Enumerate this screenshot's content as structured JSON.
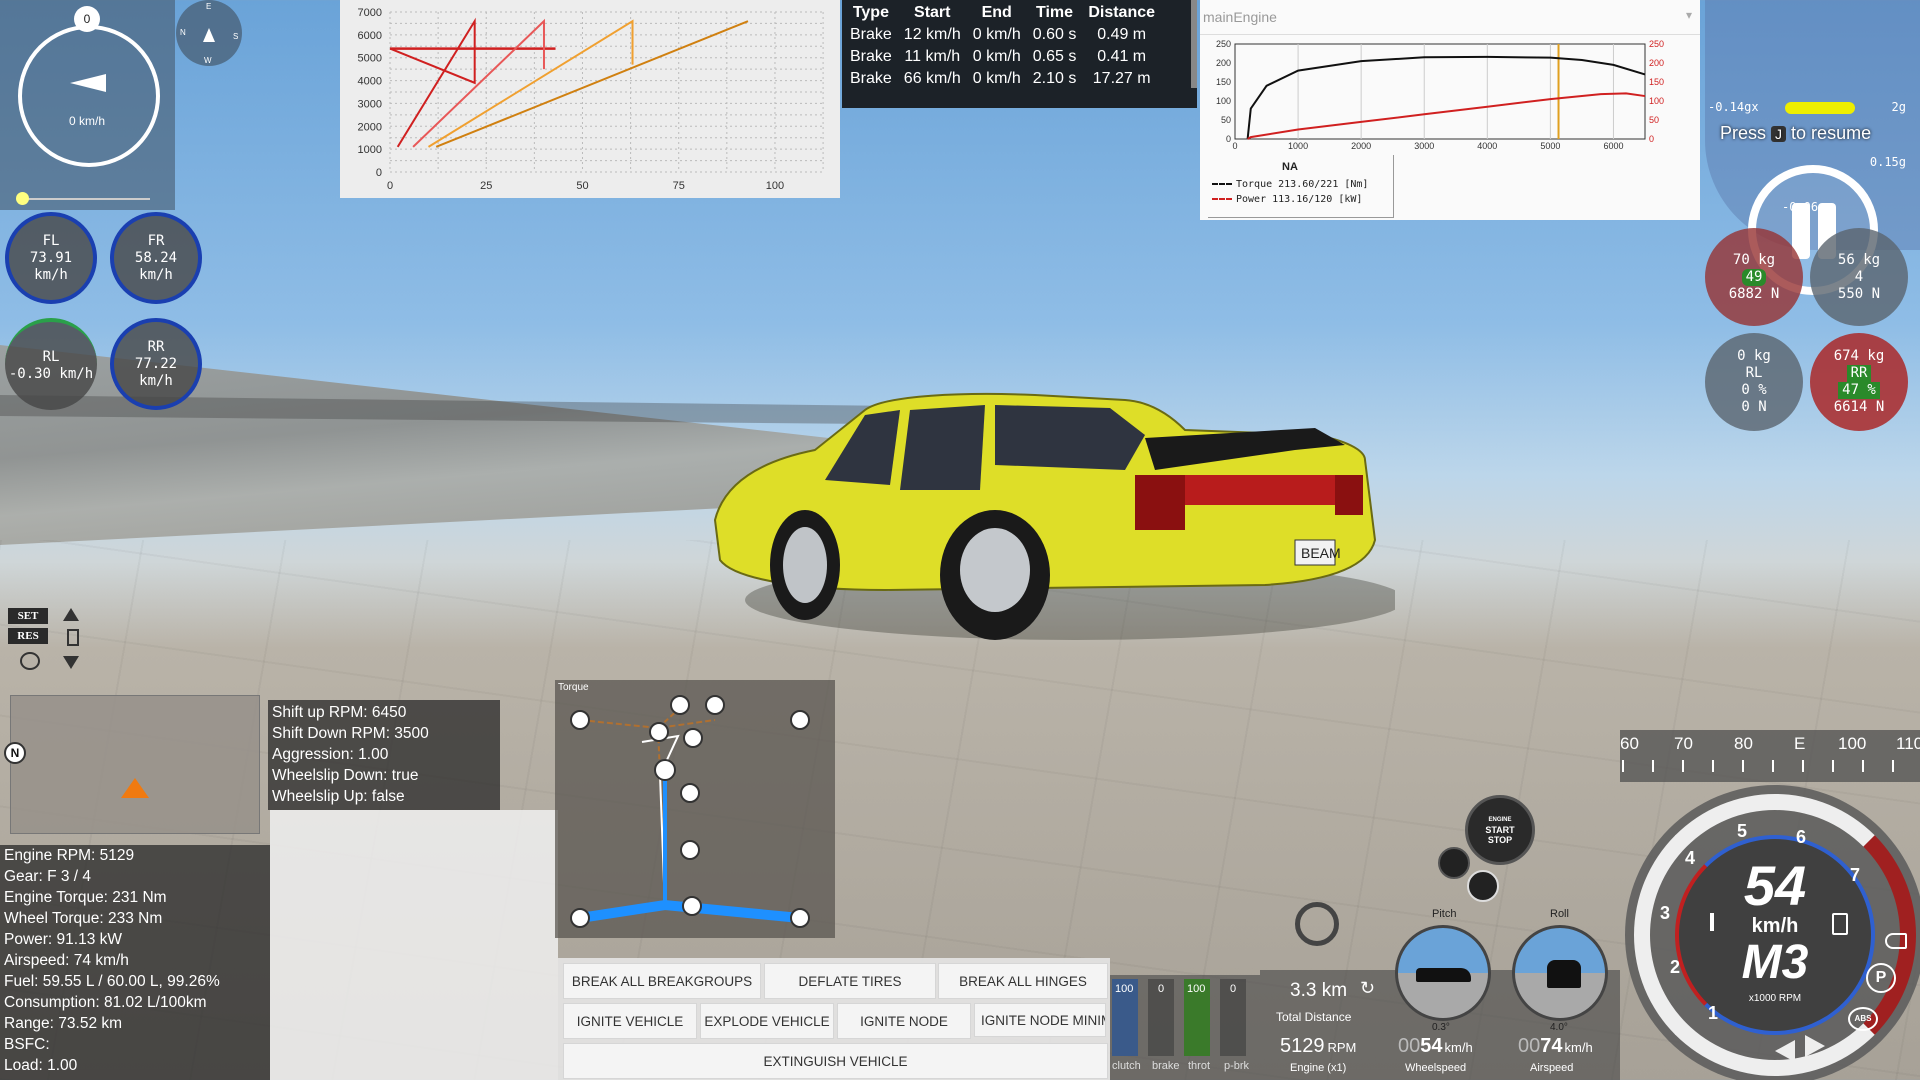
{
  "compass_speed": {
    "top_badge": "0",
    "speed": "0 km/h"
  },
  "mini_compass": {
    "n": "N",
    "e": "E",
    "s": "S",
    "w": "W"
  },
  "wheel_speeds": [
    {
      "name": "FL",
      "value": "73.91 km/h"
    },
    {
      "name": "FR",
      "value": "58.24 km/h"
    },
    {
      "name": "RL",
      "value": "-0.30 km/h"
    },
    {
      "name": "RR",
      "value": "77.22 km/h"
    }
  ],
  "cruise": {
    "set": "SET",
    "res": "RES"
  },
  "map": {
    "north": "N"
  },
  "shift_info": [
    "Shift up RPM: 6450",
    "Shift Down RPM: 3500",
    "Aggression: 1.00",
    "Wheelslip Down: true",
    "Wheelslip Up: false"
  ],
  "engine_info": [
    "Engine RPM: 5129",
    "Gear: F 3 / 4",
    "Engine Torque: 231 Nm",
    "Wheel Torque: 233 Nm",
    "Power: 91.13 kW",
    "Airspeed: 74 km/h",
    "Fuel: 59.55 L / 60.00 L, 99.26%",
    "Consumption: 81.02 L/100km",
    "Range: 73.52 km",
    "BSFC:",
    "Load: 1.00"
  ],
  "powertrain": {
    "title": "Torque"
  },
  "buttons": {
    "break_breakgroups": "BREAK ALL BREAKGROUPS",
    "deflate": "DEFLATE TIRES",
    "break_hinges": "BREAK ALL HINGES",
    "ignite_vehicle": "IGNITE VEHICLE",
    "explode": "EXPLODE VEHICLE",
    "ignite_node": "IGNITE NODE",
    "ignite_node_min": "IGNITE NODE MINIM",
    "extinguish": "EXTINGUISH VEHICLE"
  },
  "brake_table": {
    "headers": [
      "Type",
      "Start",
      "End",
      "Time",
      "Distance"
    ],
    "rows": [
      [
        "Brake",
        "12 km/h",
        "0 km/h",
        "0.60 s",
        "0.49 m"
      ],
      [
        "Brake",
        "11 km/h",
        "0 km/h",
        "0.65 s",
        "0.41 m"
      ],
      [
        "Brake",
        "66 km/h",
        "0 km/h",
        "2.10 s",
        "17.27 m"
      ]
    ]
  },
  "engine_chart": {
    "selector": "mainEngine",
    "legend_title": "NA",
    "torque_label": "Torque 213.60/221 [Nm]",
    "power_label": "Power 113.16/120 [kW]"
  },
  "chart_data": [
    {
      "type": "line",
      "title": "",
      "xlabel": "",
      "ylabel": "",
      "xlim": [
        0,
        113
      ],
      "ylim": [
        0,
        7000
      ],
      "x_ticks": [
        "0",
        "25",
        "50",
        "75",
        "100"
      ],
      "y_ticks": [
        "0",
        "1000",
        "2000",
        "3000",
        "4000",
        "5000",
        "6000",
        "7000"
      ],
      "series": [
        {
          "color": "#d02020",
          "points": [
            [
              2,
              1100
            ],
            [
              22,
              6600
            ],
            [
              22,
              3900
            ],
            [
              0,
              5400
            ]
          ]
        },
        {
          "color": "#e85858",
          "points": [
            [
              6,
              1100
            ],
            [
              40,
              6600
            ],
            [
              40,
              4500
            ]
          ]
        },
        {
          "color": "#f0a030",
          "points": [
            [
              10,
              1100
            ],
            [
              63,
              6600
            ],
            [
              63,
              4700
            ]
          ]
        },
        {
          "color": "#d08010",
          "points": [
            [
              12,
              1100
            ],
            [
              93,
              6600
            ]
          ]
        }
      ],
      "line_5400": {
        "color": "#d02020",
        "y": 5400
      }
    },
    {
      "type": "line",
      "title": "",
      "xlabel": "",
      "ylabel": "",
      "xlim": [
        0,
        6500
      ],
      "ylim_left": [
        0,
        250
      ],
      "ylim_right": [
        0,
        250
      ],
      "x_ticks": [
        "0",
        "1000",
        "2000",
        "3000",
        "4000",
        "5000",
        "6000"
      ],
      "y_ticks": [
        "0",
        "50",
        "100",
        "150",
        "200",
        "250"
      ],
      "marker_rpm": 5129,
      "series": [
        {
          "name": "Torque",
          "color": "#111111",
          "points": [
            [
              200,
              0
            ],
            [
              250,
              80
            ],
            [
              500,
              140
            ],
            [
              1000,
              180
            ],
            [
              2000,
              205
            ],
            [
              3000,
              215
            ],
            [
              4000,
              216
            ],
            [
              5000,
              214
            ],
            [
              5500,
              208
            ],
            [
              6000,
              195
            ],
            [
              6500,
              170
            ]
          ]
        },
        {
          "name": "Power",
          "color": "#d02020",
          "points": [
            [
              200,
              0
            ],
            [
              250,
              5
            ],
            [
              1000,
              25
            ],
            [
              2000,
              45
            ],
            [
              3000,
              65
            ],
            [
              4000,
              85
            ],
            [
              5000,
              105
            ],
            [
              5800,
              118
            ],
            [
              6200,
              120
            ],
            [
              6500,
              113
            ]
          ]
        }
      ]
    }
  ],
  "g_meter": {
    "left": "-0.14gx",
    "right": "2g",
    "mid": "0.15g",
    "low": "-0.06gy"
  },
  "pause": {
    "press": "Press",
    "key": "J",
    "resume": "to resume"
  },
  "tire_pressure": [
    {
      "kg": "70 kg",
      "pct": "49",
      "n": "6882 N"
    },
    {
      "kg": "56 kg",
      "pct": "4",
      "n": "550 N"
    },
    {
      "kg": "0 kg",
      "name": "RL",
      "pct": "0 %",
      "n": "0 N"
    },
    {
      "kg": "674 kg",
      "name": "RR",
      "pct": "47 %",
      "n": "6614 N"
    }
  ],
  "heading_tape": [
    "60",
    "70",
    "80",
    "E",
    "100",
    "110"
  ],
  "engine_button": {
    "line1": "ENGINE",
    "line2": "START",
    "line3": "STOP"
  },
  "pedals": [
    {
      "label": "clutch",
      "value": "100",
      "level": 1.0
    },
    {
      "label": "brake",
      "value": "0",
      "level": 0
    },
    {
      "label": "throt",
      "value": "100",
      "level": 1.0
    },
    {
      "label": "p-brk",
      "value": "0",
      "level": 0
    }
  ],
  "trip": {
    "distance": "3.3 km",
    "distance_label": "Total Distance",
    "rpm": "5129",
    "rpm_unit": "RPM",
    "rpm_label": "Engine (x1)",
    "wheelspeed_pre": "00",
    "wheelspeed": "54",
    "wheelspeed_unit": "km/h",
    "wheelspeed_label": "Wheelspeed",
    "airspeed_pre": "00",
    "airspeed": "74",
    "airspeed_unit": "km/h",
    "airspeed_label": "Airspeed"
  },
  "attitude": {
    "pitch_label": "Pitch",
    "pitch_val": "0.3°",
    "roll_label": "Roll",
    "roll_val": "4.0°"
  },
  "speedo": {
    "speed": "54",
    "unit": "km/h",
    "gear": "M3",
    "scale": "x1000 RPM",
    "ticks": [
      "1",
      "2",
      "3",
      "4",
      "5",
      "6",
      "7"
    ],
    "park": "P",
    "abs": "ABS"
  }
}
